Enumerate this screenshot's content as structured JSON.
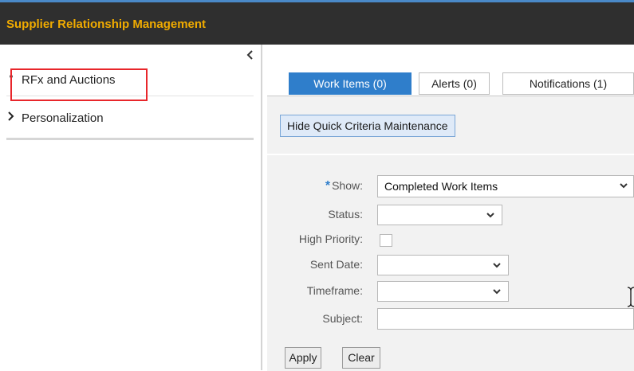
{
  "header": {
    "title": "Supplier Relationship Management",
    "accent_color": "#f0ab00",
    "bar_color": "#2f2f2f"
  },
  "sidebar": {
    "collapse_icon": "chevron-left-icon",
    "items": [
      {
        "label": "RFx and Auctions",
        "marker": "•",
        "selected": true
      },
      {
        "label": "Personalization",
        "marker": "›"
      }
    ],
    "highlight_color": "#e8262b"
  },
  "tabs": [
    {
      "label": "Work Items (0)",
      "active": true
    },
    {
      "label": "Alerts (0)",
      "active": false
    },
    {
      "label": "Notifications (1)",
      "active": false
    }
  ],
  "toolbar": {
    "toggle_label": "Hide Quick Criteria Maintenance"
  },
  "form": {
    "required_marker": "*",
    "show": {
      "label": "Show:",
      "value": "Completed Work Items"
    },
    "status": {
      "label": "Status:",
      "value": ""
    },
    "high_priority": {
      "label": "High Priority:",
      "checked": false
    },
    "sent_date": {
      "label": "Sent Date:",
      "value": ""
    },
    "timeframe": {
      "label": "Timeframe:",
      "value": ""
    },
    "subject": {
      "label": "Subject:",
      "value": ""
    }
  },
  "actions": {
    "apply_label": "Apply",
    "clear_label": "Clear"
  },
  "theme": {
    "tab_active": "#2f7ecb",
    "panel_bg": "#f2f2f2"
  }
}
